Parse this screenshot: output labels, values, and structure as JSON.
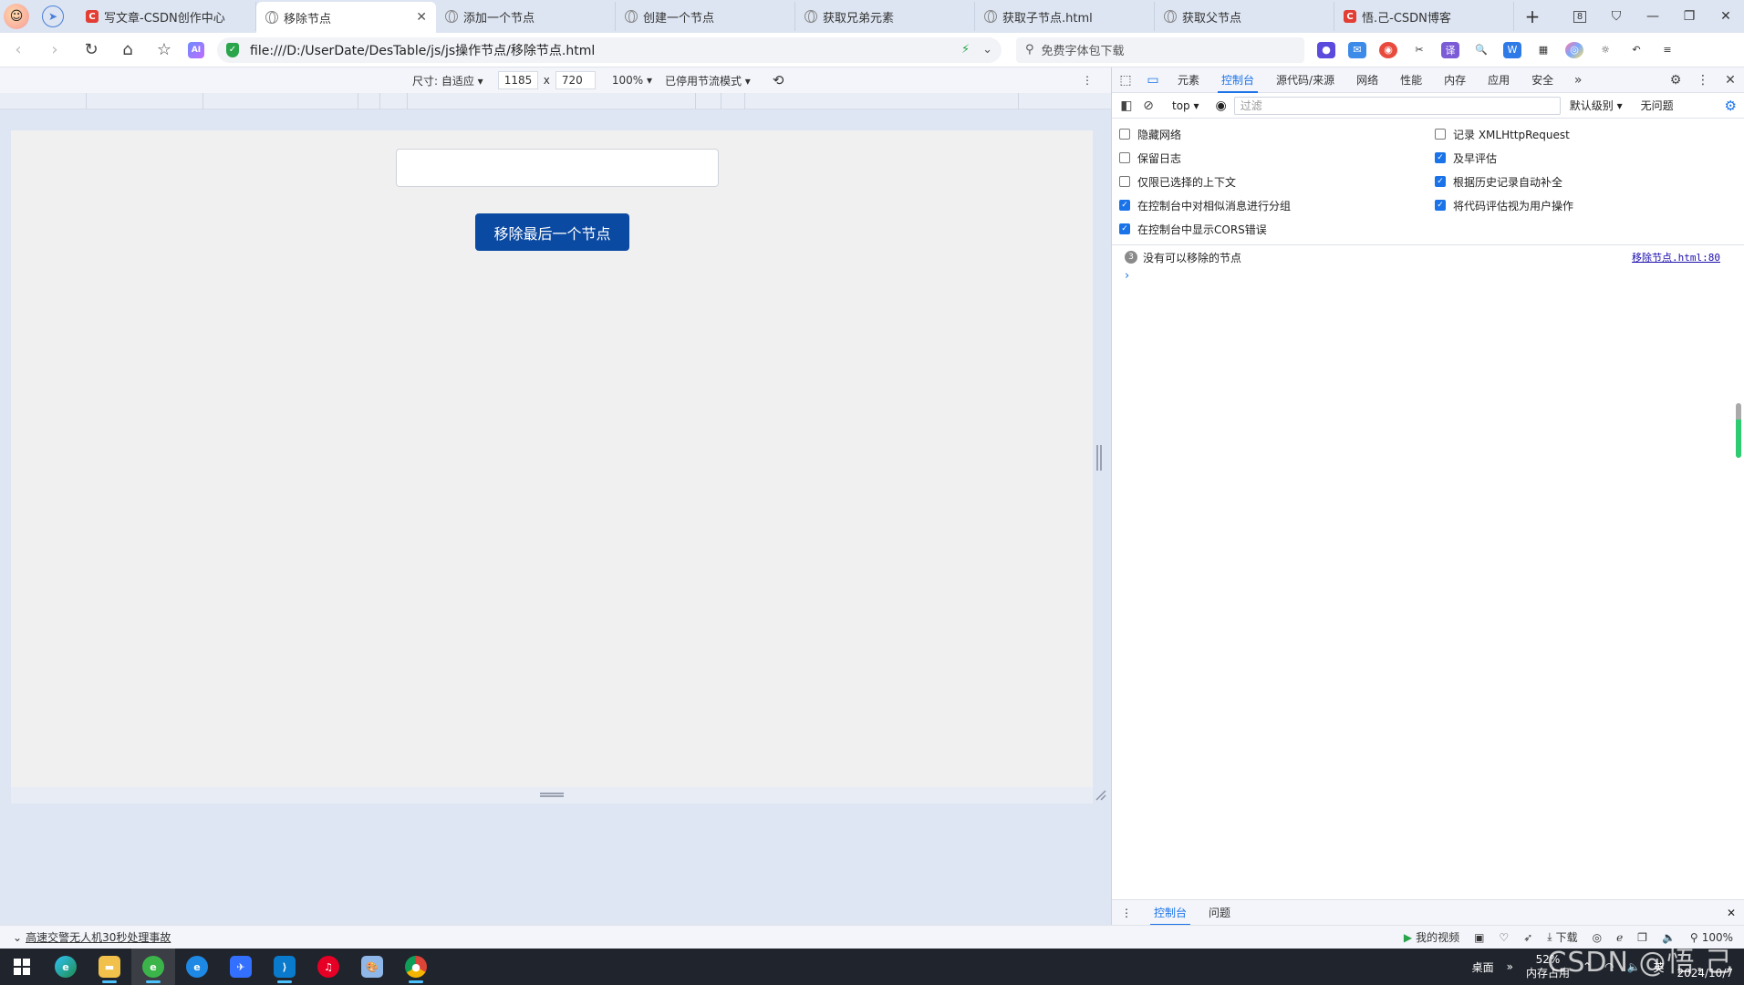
{
  "browser": {
    "tabs": [
      {
        "label": "写文章-CSDN创作中心",
        "icon": "csdn-icon",
        "active": false
      },
      {
        "label": "移除节点",
        "icon": "globe-icon",
        "active": true
      },
      {
        "label": "添加一个节点",
        "icon": "globe-icon",
        "active": false
      },
      {
        "label": "创建一个节点",
        "icon": "globe-icon",
        "active": false
      },
      {
        "label": "获取兄弟元素",
        "icon": "globe-icon",
        "active": false
      },
      {
        "label": "获取子节点.html",
        "icon": "globe-icon",
        "active": false
      },
      {
        "label": "获取父节点",
        "icon": "globe-icon",
        "active": false
      },
      {
        "label": "悟.己-CSDN博客",
        "icon": "csdn-icon",
        "active": false
      }
    ],
    "tab_count_badge": "8",
    "url": "file:///D:/UserDate/DesTable/js/js操作节点/移除节点.html",
    "search_placeholder": "免费字体包下载",
    "ai_badge": "AI"
  },
  "device_toolbar": {
    "size_label": "尺寸: 自适应",
    "width": "1185",
    "times": "x",
    "height": "720",
    "zoom": "100%",
    "throttle": "已停用节流模式"
  },
  "page": {
    "button_label": "移除最后一个节点",
    "input_value": ""
  },
  "devtools": {
    "tabs": [
      "元素",
      "控制台",
      "源代码/来源",
      "网络",
      "性能",
      "内存",
      "应用",
      "安全"
    ],
    "active_tab": "控制台",
    "context": "top",
    "filter_placeholder": "过滤",
    "level": "默认级别",
    "issues": "无问题",
    "settings": [
      {
        "label": "隐藏网络",
        "checked": false
      },
      {
        "label": "记录 XMLHttpRequest",
        "checked": false
      },
      {
        "label": "保留日志",
        "checked": false
      },
      {
        "label": "及早评估",
        "checked": true
      },
      {
        "label": "仅限已选择的上下文",
        "checked": false
      },
      {
        "label": "根据历史记录自动补全",
        "checked": true
      },
      {
        "label": "在控制台中对相似消息进行分组",
        "checked": true
      },
      {
        "label": "将代码评估视为用户操作",
        "checked": true
      },
      {
        "label": "在控制台中显示CORS错误",
        "checked": true
      }
    ],
    "message": {
      "count": "3",
      "text": "没有可以移除的节点",
      "source": "移除节点.html:80"
    },
    "prompt": "›",
    "drawer_tabs": [
      "控制台",
      "问题"
    ]
  },
  "statusbar": {
    "news": "高速交警无人机30秒处理事故",
    "my_video": "我的视频",
    "download": "下载",
    "zoom": "100%"
  },
  "taskbar": {
    "desktop": "桌面",
    "mem_percent": "52%",
    "mem_label": "内存占用",
    "ime": "英",
    "date": "2024/10/7"
  },
  "watermark": "CSDN @悟.己",
  "colors": {
    "accent": "#1a73e8",
    "button_bg": "#0b4aa2",
    "csdn_red": "#e33e33"
  }
}
